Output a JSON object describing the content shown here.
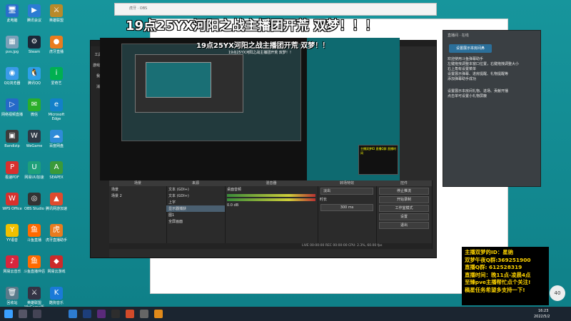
{
  "desktop_icons": [
    {
      "label": "此电脑",
      "color": "#2a6ecb",
      "glyph": "🖥"
    },
    {
      "label": "腾讯会议",
      "color": "#2b7cd3",
      "glyph": "▶"
    },
    {
      "label": "英雄联盟",
      "color": "#b88a2a",
      "glyph": "⚔"
    },
    {
      "label": "pvs.jpg",
      "color": "#7aa0b8",
      "glyph": "▦"
    },
    {
      "label": "Steam",
      "color": "#1b2838",
      "glyph": "⚙"
    },
    {
      "label": "虎牙直播",
      "color": "#e87c1f",
      "glyph": "●"
    },
    {
      "label": "QQ浏览器",
      "color": "#3a9ae8",
      "glyph": "◉"
    },
    {
      "label": "腾讯QQ",
      "color": "#2da0e8",
      "glyph": "🐧"
    },
    {
      "label": "爱奇艺",
      "color": "#00b050",
      "glyph": "i"
    },
    {
      "label": "网络视频直播",
      "color": "#2569c8",
      "glyph": "▷"
    },
    {
      "label": "微信",
      "color": "#2aae2a",
      "glyph": "✉"
    },
    {
      "label": "Microsoft Edge",
      "color": "#1380c9",
      "glyph": "e"
    },
    {
      "label": "Bandizip",
      "color": "#3c3c3c",
      "glyph": "▣"
    },
    {
      "label": "WeGame",
      "color": "#2e3a46",
      "glyph": "W"
    },
    {
      "label": "百度网盘",
      "color": "#2f8bd8",
      "glyph": "☁"
    },
    {
      "label": "极速PDF",
      "color": "#d8302e",
      "glyph": "P"
    },
    {
      "label": "网易UU加速",
      "color": "#1ea07a",
      "glyph": "U"
    },
    {
      "label": "SEAPEX",
      "color": "#3a9a3a",
      "glyph": "A"
    },
    {
      "label": "WPS Office",
      "color": "#d8312e",
      "glyph": "W"
    },
    {
      "label": "OBS Studio",
      "color": "#333",
      "glyph": "◎"
    },
    {
      "label": "腾讯网游加速",
      "color": "#e04b2e",
      "glyph": "▲"
    },
    {
      "label": "YY语音",
      "color": "#f0c000",
      "glyph": "Y"
    },
    {
      "label": "斗鱼直播",
      "color": "#ff6a00",
      "glyph": "鱼"
    },
    {
      "label": "虎牙直播助手",
      "color": "#e87c1f",
      "glyph": "虎"
    },
    {
      "label": "网易云音乐",
      "color": "#d7263d",
      "glyph": "♪"
    },
    {
      "label": "斗鱼直播伴侣",
      "color": "#ff6a00",
      "glyph": "鱼"
    },
    {
      "label": "网易云游戏",
      "color": "#cc2a2a",
      "glyph": "◆"
    },
    {
      "label": "回收站",
      "color": "#5a7a8a",
      "glyph": "🗑"
    },
    {
      "label": "英雄联盟WeGame版",
      "color": "#334",
      "glyph": "⚔"
    },
    {
      "label": "酷狗音乐",
      "color": "#1a7ad8",
      "glyph": "K"
    }
  ],
  "stream": {
    "big_title": "19点25YX河阳之战主播团开荒 双梦！！！",
    "mid_title": "19点25YX河阳之战主播团开荒 双梦！！",
    "small_title": "19点25YX河阳之战主播团开荒 双梦！！"
  },
  "obs": {
    "sidebar": [
      "工具箱",
      "游戏精选",
      "我的",
      "消息"
    ],
    "docks": {
      "scenes_header": "场景",
      "scenes": [
        "场景",
        "场景 2"
      ],
      "sources_header": "来源",
      "sources": [
        "文本 (GDI+)",
        "文本 (GDI+)",
        "上字",
        "显示器捕获",
        "图1",
        "全屏画面"
      ],
      "mixer_header": "混音器",
      "mixer_track": "桌面音频",
      "mixer_db": "0.0 dB",
      "transitions_header": "转场特效",
      "transition_value": "淡出",
      "duration_label": "时长",
      "duration_value": "300 ms",
      "controls_header": "控件",
      "controls": [
        "停止推流",
        "开始录制",
        "工作室模式",
        "设置",
        "退出"
      ]
    },
    "status": "LIVE 00:00:00  REC 00:00:00  CPU: 2.3%, 60.00 fps"
  },
  "chat": {
    "head": "直播间 · 在线",
    "button": "设置展示本房间鼻",
    "messages": [
      "欢迎使用斗鱼弹幕助手",
      "左键拖曳调整本窗口位置，右键拖拽调整大小",
      "右上角有设置菜单",
      "设置展示弹幕、进房提醒、礼物提醒等",
      "添加弹幕助手成功",
      "设置展示本房间礼物、进场、贡献开播",
      "点击单可设置小礼物屏蔽"
    ]
  },
  "info_box": [
    "主播双梦的ID：星驰",
    "双梦午夜Q群:369251900",
    "直播Q群: 612528319",
    "直播时间：晚11点-凌晨4点",
    "至臻pve主播帮忙点个关注!",
    "稿星任务希望多支持一下!"
  ],
  "badge": "40",
  "taskbar": {
    "time": "16:23",
    "date": "2022/5/2"
  }
}
